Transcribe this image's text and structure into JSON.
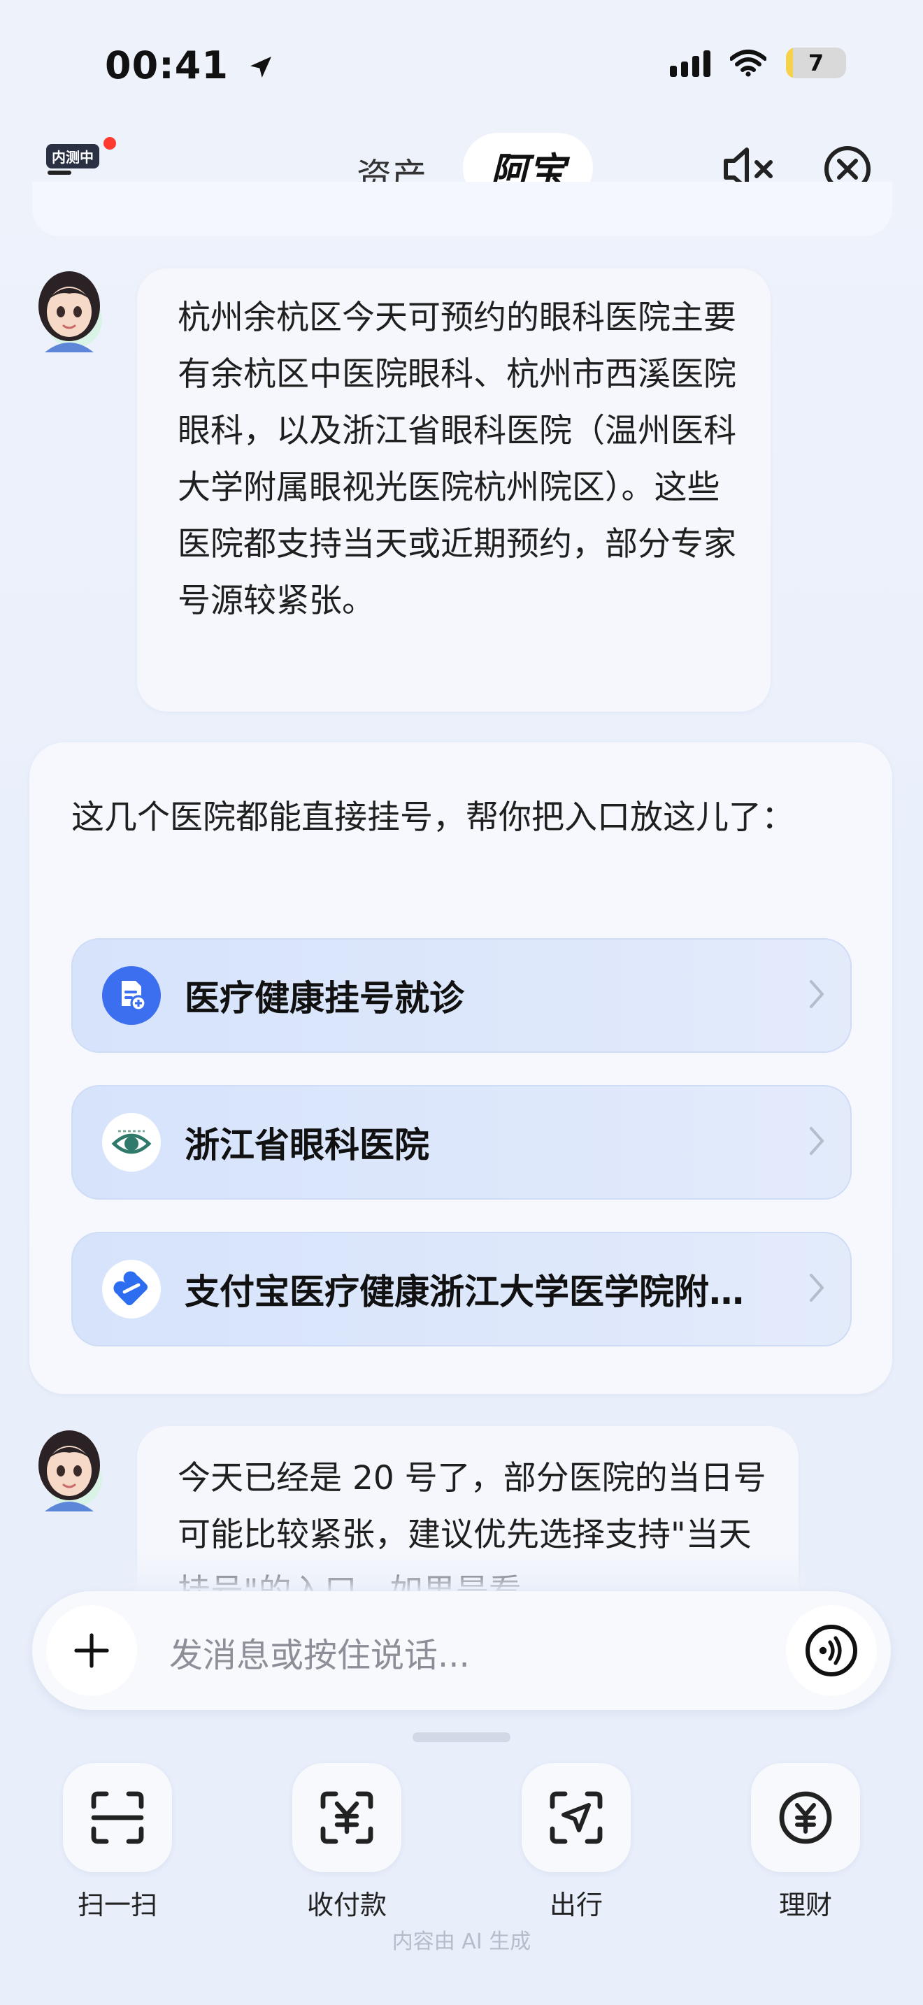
{
  "status_bar": {
    "time": "00:41",
    "battery": "7",
    "battery_level": 0.07
  },
  "header": {
    "beta_badge": "内测中",
    "tab_assets": "资产",
    "tab_abao": "阿宝"
  },
  "messages": {
    "first": "杭州余杭区今天可预约的眼科医院主要有余杭区中医院眼科、杭州市西溪医院眼科，以及浙江省眼科医院（温州医科大学附属眼视光医院杭州院区）。这些医院都支持当天或近期预约，部分专家号源较紧张。",
    "card_intro": "这几个医院都能直接挂号，帮你把入口放这儿了：",
    "links": [
      {
        "label": "医疗健康挂号就诊",
        "icon": "medical-doc-icon"
      },
      {
        "label": "浙江省眼科医院",
        "icon": "eye-hospital-logo-icon"
      },
      {
        "label": "支付宝医疗健康浙江大学医学院附…",
        "icon": "alipay-health-heart-icon"
      }
    ],
    "last": "今天已经是 20 号了，部分医院的当日号可能比较紧张，建议优先选择支持\"当天挂号\"的入口，如果是看"
  },
  "input": {
    "placeholder": "发消息或按住说话..."
  },
  "dock": [
    {
      "label": "扫一扫",
      "icon": "scan-icon"
    },
    {
      "label": "收付款",
      "icon": "payment-icon"
    },
    {
      "label": "出行",
      "icon": "travel-icon"
    },
    {
      "label": "理财",
      "icon": "finance-icon"
    }
  ],
  "footer_note": "内容由 AI 生成",
  "colors": {
    "accent": "#3b6ff0",
    "link_bg": "#d6e3fb",
    "battery": "#f6d24b"
  }
}
